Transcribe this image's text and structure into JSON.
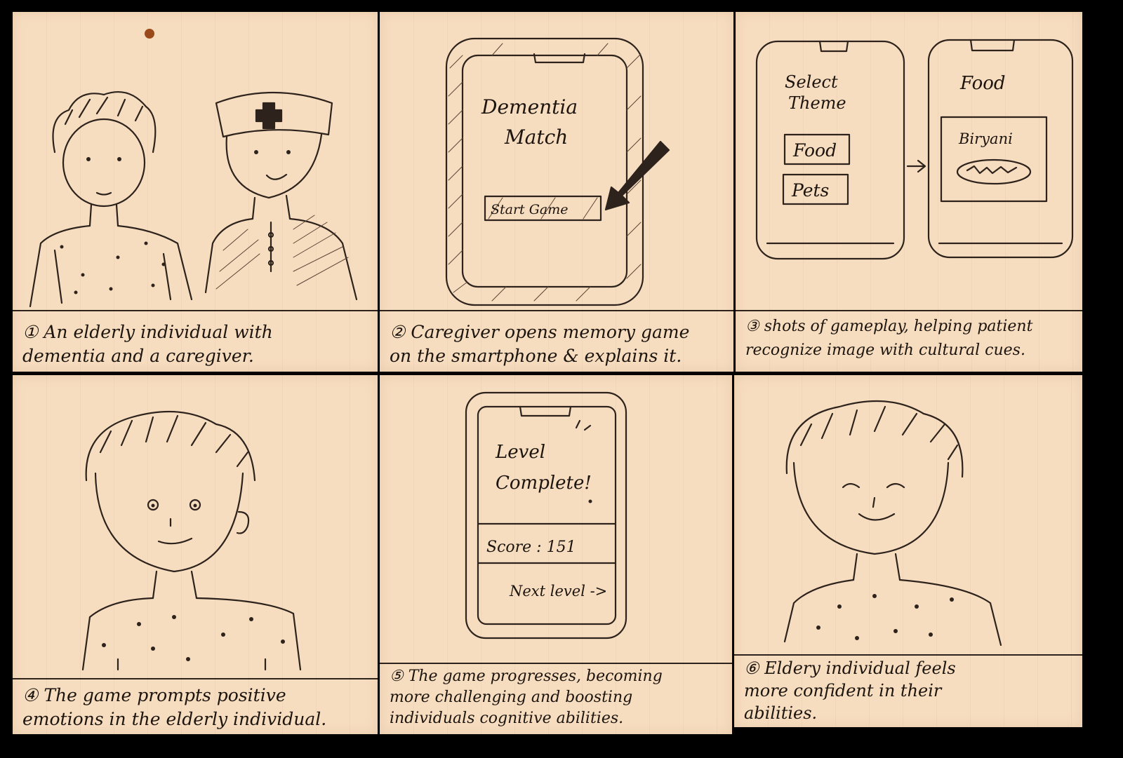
{
  "panels": [
    {
      "caption_line1": "① An elderly individual with",
      "caption_line2": "dementia and a caregiver."
    },
    {
      "screen_title_line1": "Dementia",
      "screen_title_line2": "Match",
      "button_label": "Start Game",
      "caption_line1": "② Caregiver opens memory game",
      "caption_line2": "on the smartphone & explains it."
    },
    {
      "left_title_line1": "Select",
      "left_title_line2": "Theme",
      "option_food": "Food",
      "option_pets": "Pets",
      "right_title": "Food",
      "card_label": "Biryani",
      "caption_line1": "③ shots of gameplay, helping patient",
      "caption_line2": "recognize image with cultural cues."
    },
    {
      "caption_line1": "④ The game prompts positive",
      "caption_line2": "emotions in the elderly individual."
    },
    {
      "screen_title_line1": "Level",
      "screen_title_line2": "Complete!",
      "score_label": "Score : 151",
      "next_label": "Next level ->",
      "caption_line1": "⑤ The game progresses, becoming",
      "caption_line2": "more challenging and boosting",
      "caption_line3": "individuals cognitive abilities."
    },
    {
      "caption_line1": "⑥ Eldery individual feels",
      "caption_line2": "more confident in their",
      "caption_line3": "abilities."
    }
  ]
}
